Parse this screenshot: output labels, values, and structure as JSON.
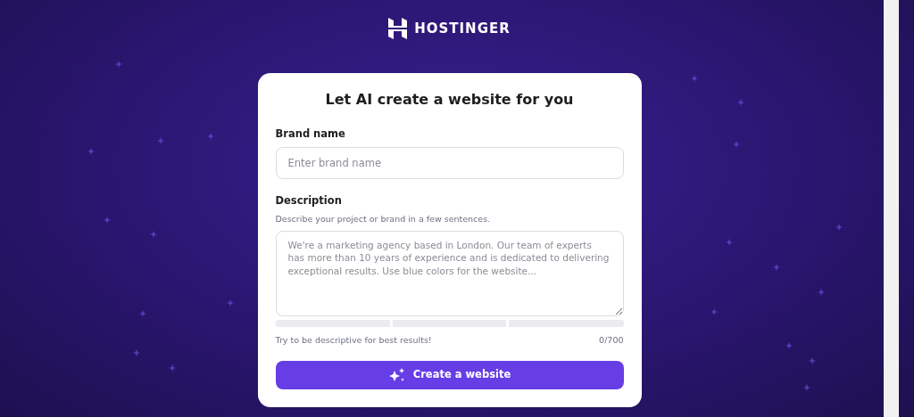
{
  "header": {
    "logo_text": "HOSTINGER"
  },
  "form": {
    "title": "Let AI create a website for you",
    "brand_name": {
      "label": "Brand name",
      "placeholder": "Enter brand name"
    },
    "description": {
      "label": "Description",
      "hint": "Describe your project or brand in a few sentences.",
      "placeholder": "We're a marketing agency based in London. Our team of experts has more than 10 years of experience and is dedicated to delivering exceptional results. Use blue colors for the website...",
      "strength": {
        "level": 0
      },
      "tip": "Try to be descriptive for best results!",
      "counter": "0/700"
    },
    "submit": {
      "label": "Create a website"
    }
  }
}
